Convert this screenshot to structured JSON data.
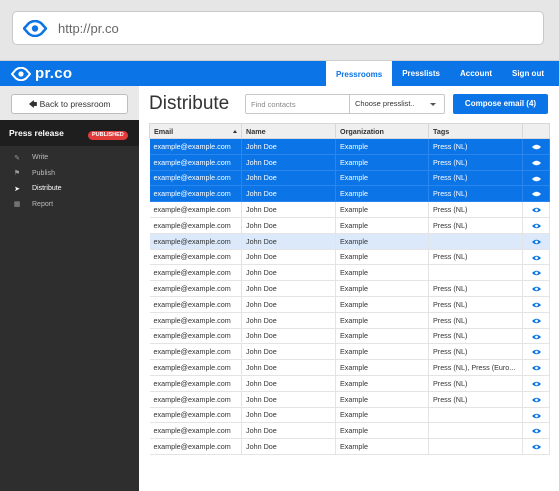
{
  "browser": {
    "url": "http://pr.co"
  },
  "topnav": {
    "logo_text": "pr.co",
    "items": [
      {
        "label": "Pressrooms",
        "active": true
      },
      {
        "label": "Presslists",
        "active": false
      },
      {
        "label": "Account",
        "active": false
      },
      {
        "label": "Sign out",
        "active": false
      }
    ]
  },
  "sidebar": {
    "back_label": "Back to pressroom",
    "section_label": "Press release",
    "status_badge": "PUBLISHED",
    "items": [
      {
        "label": "Write",
        "icon": "pencil-icon",
        "active": false
      },
      {
        "label": "Publish",
        "icon": "flag-icon",
        "active": false
      },
      {
        "label": "Distribute",
        "icon": "send-icon",
        "active": true
      },
      {
        "label": "Report",
        "icon": "chart-icon",
        "active": false
      }
    ]
  },
  "main": {
    "title": "Distribute",
    "search_placeholder": "Find contacts",
    "presslist_select": "Choose presslist..",
    "compose_label": "Compose email (4)",
    "columns": [
      "Email",
      "Name",
      "Organization",
      "Tags"
    ],
    "rows": [
      {
        "email": "example@example.com",
        "name": "John Doe",
        "org": "Example",
        "tags": "Press (NL)",
        "state": "selected"
      },
      {
        "email": "example@example.com",
        "name": "John Doe",
        "org": "Example",
        "tags": "Press (NL)",
        "state": "selected"
      },
      {
        "email": "example@example.com",
        "name": "John Doe",
        "org": "Example",
        "tags": "Press (NL)",
        "state": "selected"
      },
      {
        "email": "example@example.com",
        "name": "John Doe",
        "org": "Example",
        "tags": "Press (NL)",
        "state": "selected"
      },
      {
        "email": "example@example.com",
        "name": "John Doe",
        "org": "Example",
        "tags": "Press (NL)",
        "state": "normal"
      },
      {
        "email": "example@example.com",
        "name": "John Doe",
        "org": "Example",
        "tags": "Press (NL)",
        "state": "normal"
      },
      {
        "email": "example@example.com",
        "name": "John Doe",
        "org": "Example",
        "tags": "",
        "state": "hover"
      },
      {
        "email": "example@example.com",
        "name": "John Doe",
        "org": "Example",
        "tags": "Press (NL)",
        "state": "normal"
      },
      {
        "email": "example@example.com",
        "name": "John Doe",
        "org": "Example",
        "tags": "",
        "state": "normal"
      },
      {
        "email": "example@example.com",
        "name": "John Doe",
        "org": "Example",
        "tags": "Press (NL)",
        "state": "normal"
      },
      {
        "email": "example@example.com",
        "name": "John Doe",
        "org": "Example",
        "tags": "Press (NL)",
        "state": "normal"
      },
      {
        "email": "example@example.com",
        "name": "John Doe",
        "org": "Example",
        "tags": "Press (NL)",
        "state": "normal"
      },
      {
        "email": "example@example.com",
        "name": "John Doe",
        "org": "Example",
        "tags": "Press (NL)",
        "state": "normal"
      },
      {
        "email": "example@example.com",
        "name": "John Doe",
        "org": "Example",
        "tags": "Press (NL)",
        "state": "normal"
      },
      {
        "email": "example@example.com",
        "name": "John Doe",
        "org": "Example",
        "tags": "Press (NL), Press (Euro...",
        "state": "normal"
      },
      {
        "email": "example@example.com",
        "name": "John Doe",
        "org": "Example",
        "tags": "Press (NL)",
        "state": "normal"
      },
      {
        "email": "example@example.com",
        "name": "John Doe",
        "org": "Example",
        "tags": "Press (NL)",
        "state": "normal"
      },
      {
        "email": "example@example.com",
        "name": "John Doe",
        "org": "Example",
        "tags": "",
        "state": "normal"
      },
      {
        "email": "example@example.com",
        "name": "John Doe",
        "org": "Example",
        "tags": "",
        "state": "normal"
      },
      {
        "email": "example@example.com",
        "name": "John Doe",
        "org": "Example",
        "tags": "",
        "state": "normal"
      }
    ]
  },
  "colors": {
    "brand": "#0b74e6",
    "badge": "#e23b3b",
    "sidebar": "#2e2e2e"
  }
}
